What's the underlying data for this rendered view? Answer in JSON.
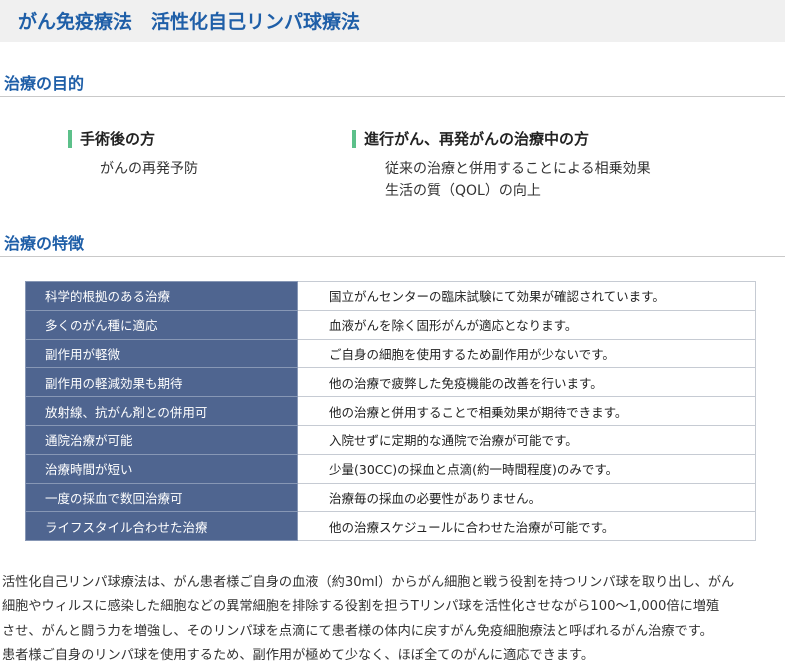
{
  "title": "がん免疫療法　活性化自己リンパ球療法",
  "purpose": {
    "heading": "治療の目的",
    "left": {
      "heading": "手術後の方",
      "items": [
        "がんの再発予防"
      ]
    },
    "right": {
      "heading": "進行がん、再発がんの治療中の方",
      "items": [
        "従来の治療と併用することによる相乗効果",
        "生活の質（QOL）の向上"
      ]
    }
  },
  "features": {
    "heading": "治療の特徴",
    "rows": [
      {
        "feature": "科学的根拠のある治療",
        "detail": "国立がんセンターの臨床試験にて効果が確認されています。"
      },
      {
        "feature": "多くのがん種に適応",
        "detail": "血液がんを除く固形がんが適応となります。"
      },
      {
        "feature": "副作用が軽微",
        "detail": "ご自身の細胞を使用するため副作用が少ないです。"
      },
      {
        "feature": "副作用の軽減効果も期待",
        "detail": "他の治療で疲弊した免疫機能の改善を行います。"
      },
      {
        "feature": "放射線、抗がん剤との併用可",
        "detail": "他の治療と併用することで相乗効果が期待できます。"
      },
      {
        "feature": "通院治療が可能",
        "detail": "入院せずに定期的な通院で治療が可能です。"
      },
      {
        "feature": "治療時間が短い",
        "detail": "少量(30CC)の採血と点滴(約一時間程度)のみです。"
      },
      {
        "feature": "一度の採血で数回治療可",
        "detail": "治療毎の採血の必要性がありません。"
      },
      {
        "feature": "ライフスタイル合わせた治療",
        "detail": "他の治療スケジュールに合わせた治療が可能です。"
      }
    ]
  },
  "description": [
    "活性化自己リンパ球療法は、がん患者様ご自身の血液（約30ml）からがん細胞と戦う役割を持つリンパ球を取り出し、がん",
    "細胞やウィルスに感染した細胞などの異常細胞を排除する役割を担うTリンパ球を活性化させながら100～1,000倍に増殖",
    "させ、がんと闘う力を増強し、そのリンパ球を点滴にて患者様の体内に戻すがん免疫細胞療法と呼ばれるがん治療です。",
    "患者様ご自身のリンパ球を使用するため、副作用が極めて少なく、ほぼ全てのがんに適応できます。"
  ],
  "colors": {
    "title_text": "#1f5fa8",
    "header_bg": "#f0f0f0",
    "accent_bar": "#5cc08a",
    "table_key_bg": "#4f6590"
  }
}
